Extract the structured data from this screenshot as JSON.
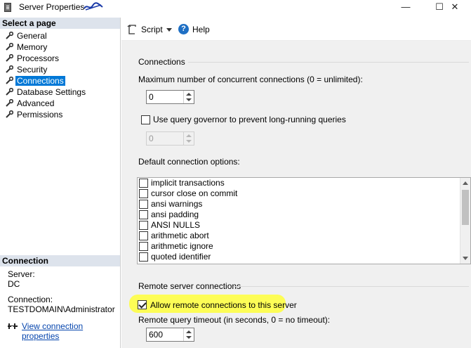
{
  "window": {
    "title": "Server Properties",
    "minimize_glyph": "—",
    "maximize_glyph": "☐",
    "close_glyph": "✕"
  },
  "left_pane": {
    "select_page_header": "Select a page",
    "pages": [
      {
        "label": "General"
      },
      {
        "label": "Memory"
      },
      {
        "label": "Processors"
      },
      {
        "label": "Security"
      },
      {
        "label": "Connections",
        "selected": true
      },
      {
        "label": "Database Settings"
      },
      {
        "label": "Advanced"
      },
      {
        "label": "Permissions"
      }
    ],
    "connection_header": "Connection",
    "server_label": "Server:",
    "server_value": "DC",
    "connection_label": "Connection:",
    "connection_value": "TESTDOMAIN\\Administrator",
    "view_link": "View connection properties"
  },
  "toolbar": {
    "script_label": "Script",
    "help_label": "Help",
    "help_glyph": "?"
  },
  "connections": {
    "group_title": "Connections",
    "max_label": "Maximum number of concurrent connections (0 = unlimited):",
    "max_value": "0",
    "governor_label": "Use query governor to prevent long-running queries",
    "governor_checked": false,
    "governor_value": "0",
    "default_options_label": "Default connection options:",
    "options": [
      {
        "label": "implicit transactions",
        "checked": false
      },
      {
        "label": "cursor close on commit",
        "checked": false
      },
      {
        "label": "ansi warnings",
        "checked": false
      },
      {
        "label": "ansi padding",
        "checked": false
      },
      {
        "label": "ANSI NULLS",
        "checked": false
      },
      {
        "label": "arithmetic abort",
        "checked": false
      },
      {
        "label": "arithmetic ignore",
        "checked": false
      },
      {
        "label": "quoted identifier",
        "checked": false
      }
    ]
  },
  "remote": {
    "group_title": "Remote server connections",
    "allow_label": "Allow remote connections to this server",
    "allow_checked": true,
    "timeout_label": "Remote query timeout (in seconds, 0 = no timeout):",
    "timeout_value": "600"
  },
  "colors": {
    "selection": "#0078d7",
    "header_bg": "#dde3ec",
    "highlight": "#ffff3b",
    "link": "#0645ad"
  }
}
